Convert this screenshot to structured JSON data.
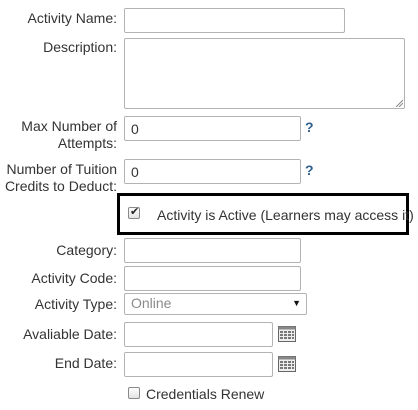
{
  "form": {
    "activity_name": {
      "label": "Activity Name:",
      "value": ""
    },
    "description": {
      "label": "Description:",
      "value": ""
    },
    "max_attempts": {
      "label_line1": "Max Number of",
      "label_line2": "Attempts:",
      "value": "0",
      "help": "?"
    },
    "tuition_credits": {
      "label_line1": "Number of Tuition",
      "label_line2": "Credits to Deduct:",
      "value": "0",
      "help": "?"
    },
    "activity_active": {
      "label": "Activity is Active (Learners may access it)",
      "checked": true
    },
    "category": {
      "label": "Category:",
      "value": ""
    },
    "activity_code": {
      "label": "Activity Code:",
      "value": ""
    },
    "activity_type": {
      "label": "Activity Type:",
      "value": "Online"
    },
    "available_date": {
      "label": "Avaliable Date:",
      "value": ""
    },
    "end_date": {
      "label": "End Date:",
      "value": ""
    },
    "credentials_renew": {
      "label": "Credentials Renew",
      "checked": false
    }
  },
  "icons": {
    "calendar": "calendar-icon",
    "dropdown": "chevron-down-icon",
    "check": "check-icon"
  },
  "colors": {
    "help": "#2e5f8c",
    "highlight_border": "#000000",
    "input_border": "#b3b3b3"
  }
}
